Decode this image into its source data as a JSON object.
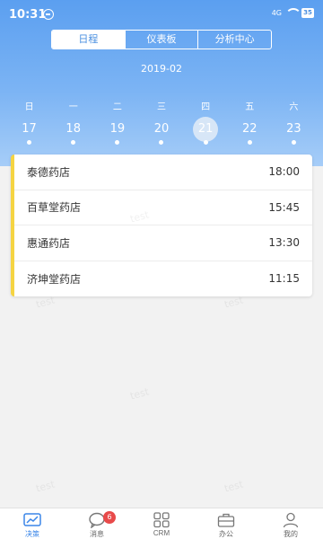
{
  "status_bar": {
    "time": "10:31",
    "signal": "4G",
    "battery": "35"
  },
  "segmented": [
    {
      "label": "日程",
      "active": true
    },
    {
      "label": "仪表板",
      "active": false
    },
    {
      "label": "分析中心",
      "active": false
    }
  ],
  "calendar": {
    "month": "2019-02",
    "weekdays": [
      "日",
      "一",
      "二",
      "三",
      "四",
      "五",
      "六"
    ],
    "days": [
      {
        "num": "17",
        "selected": false
      },
      {
        "num": "18",
        "selected": false
      },
      {
        "num": "19",
        "selected": false
      },
      {
        "num": "20",
        "selected": false
      },
      {
        "num": "21",
        "selected": true
      },
      {
        "num": "22",
        "selected": false
      },
      {
        "num": "23",
        "selected": false
      }
    ]
  },
  "schedule": [
    {
      "name": "泰德药店",
      "time": "18:00"
    },
    {
      "name": "百草堂药店",
      "time": "15:45"
    },
    {
      "name": "惠通药店",
      "time": "13:30"
    },
    {
      "name": "济坤堂药店",
      "time": "11:15"
    }
  ],
  "watermark_text": "test",
  "tabbar": [
    {
      "label": "决策",
      "icon": "chart-icon",
      "active": true
    },
    {
      "label": "消息",
      "icon": "chat-icon",
      "active": false
    },
    {
      "label": "CRM",
      "icon": "grid-icon",
      "active": false
    },
    {
      "label": "办公",
      "icon": "briefcase-icon",
      "active": false
    },
    {
      "label": "我的",
      "icon": "user-icon",
      "active": false
    }
  ],
  "message_badge": "6",
  "colors": {
    "header_top": "#5b9ff0",
    "accent": "#3b86e8",
    "list_marker": "#f5d442",
    "badge": "#e84a4a"
  }
}
